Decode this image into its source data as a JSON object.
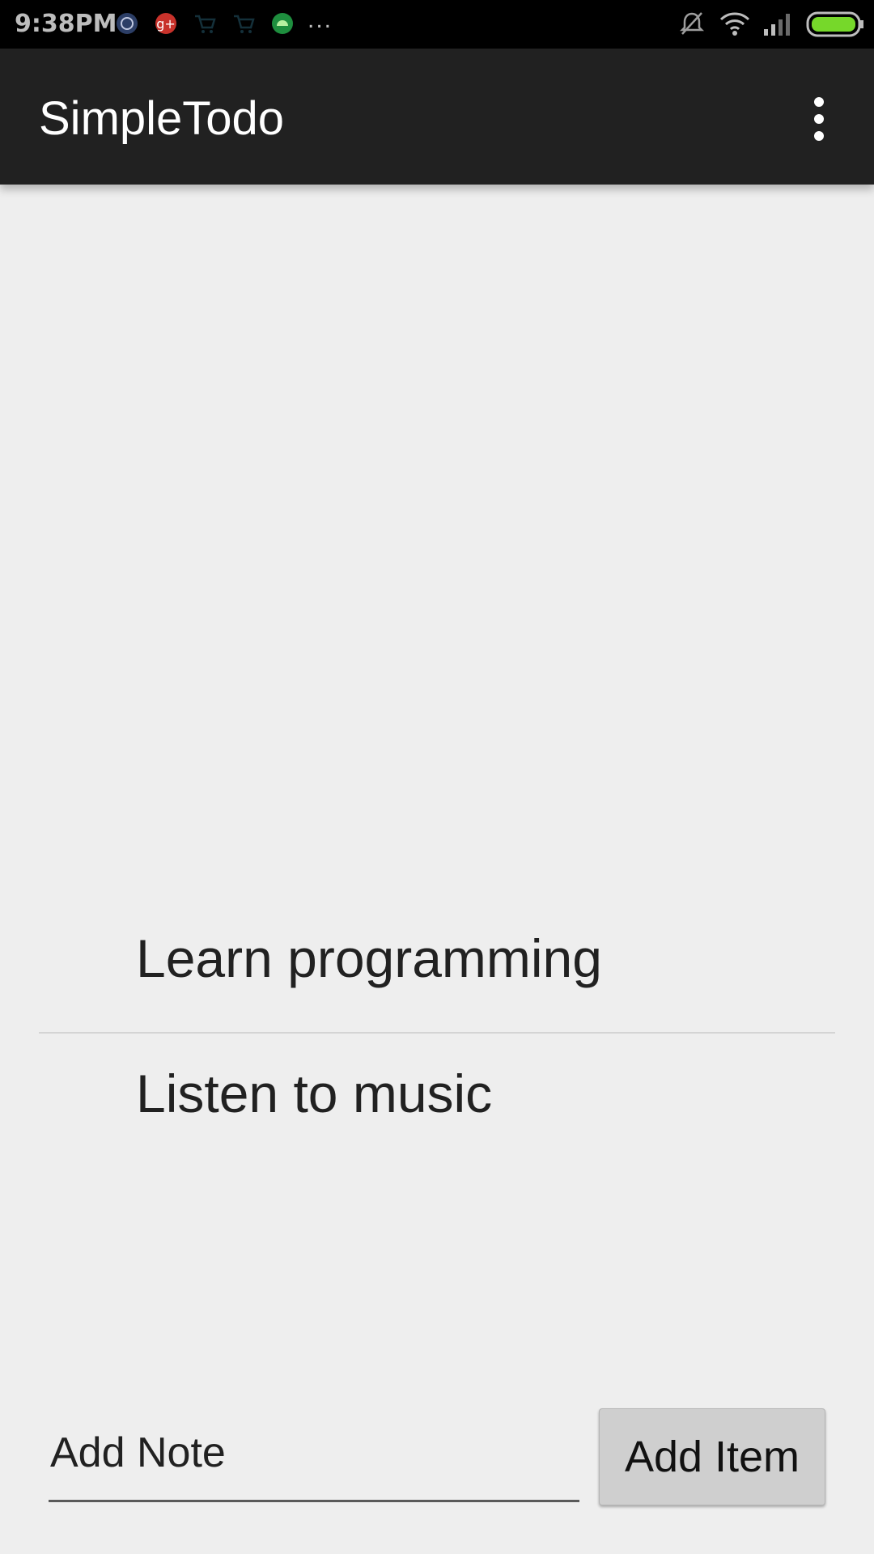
{
  "status_bar": {
    "time": "9:38PM",
    "more_indicator": "...",
    "icons": [
      "app-notification-icon",
      "google-plus-icon",
      "cart-icon",
      "cart-icon",
      "android-icon",
      "bell-muted-icon",
      "wifi-icon",
      "signal-icon",
      "battery-icon"
    ],
    "battery_color": "#76d82a"
  },
  "app_bar": {
    "title": "SimpleTodo",
    "background": "#212121",
    "menu_icon": "overflow-menu-icon"
  },
  "todo_list": {
    "items": [
      {
        "label": "Learn programming"
      },
      {
        "label": "Listen to music"
      }
    ]
  },
  "footer": {
    "note_placeholder": "Add Note",
    "add_button_label": "Add Item"
  }
}
